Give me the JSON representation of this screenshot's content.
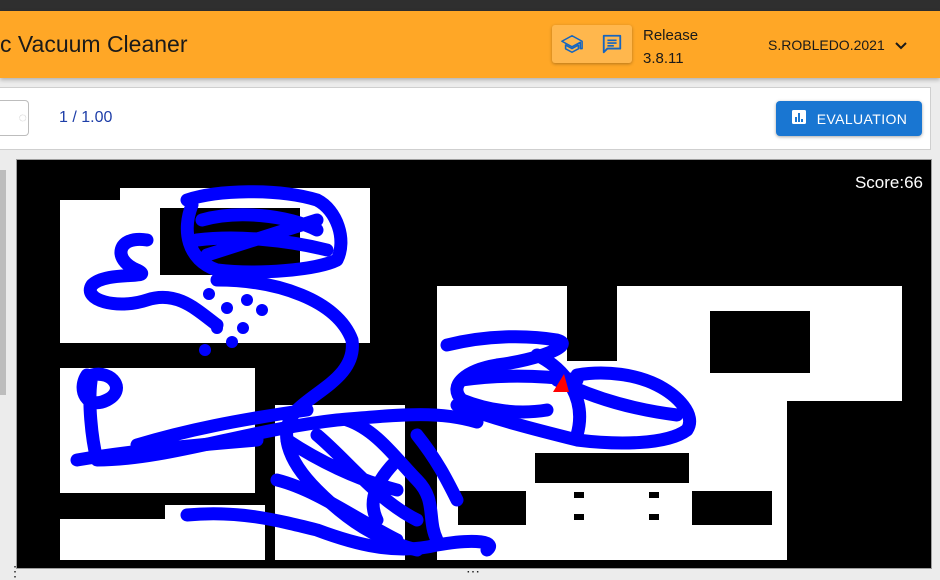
{
  "appbar": {
    "title": "c Vacuum Cleaner",
    "release_label": "Release",
    "release_version": "3.8.11",
    "user": "S.ROBLEDO.2021",
    "icons": [
      "school-icon",
      "chat-icon",
      "chevron-down-icon"
    ],
    "color": "#ffa726"
  },
  "toolbar": {
    "ratio": "1 / 1.00",
    "evaluation_label": "EVALUATION",
    "evaluation_color": "#1976d2"
  },
  "map": {
    "score": "Score:66",
    "path_color": "#0000ff",
    "robot_color": "#ff0000"
  }
}
